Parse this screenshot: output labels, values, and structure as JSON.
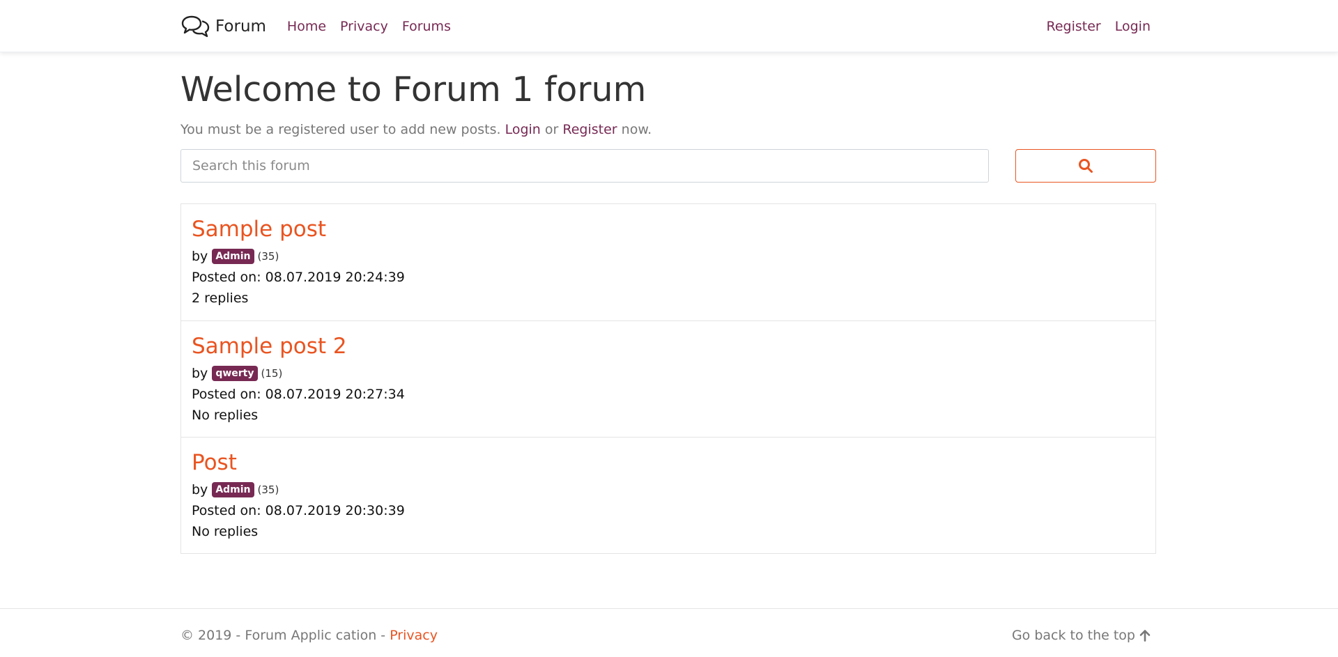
{
  "nav": {
    "brand": "Forum",
    "links": [
      "Home",
      "Privacy",
      "Forums"
    ],
    "right_links": [
      "Register",
      "Login"
    ]
  },
  "main": {
    "title": "Welcome to Forum 1 forum",
    "intro_prefix": "You must be a registered user to add new posts.",
    "intro_login": "Login",
    "intro_or": "or",
    "intro_register": "Register",
    "intro_suffix": "now."
  },
  "search": {
    "placeholder": "Search this forum",
    "value": ""
  },
  "posts": [
    {
      "title": "Sample post",
      "by": "by",
      "author": "Admin",
      "count": "(35)",
      "posted": "Posted on: 08.07.2019 20:24:39",
      "replies": "2 replies"
    },
    {
      "title": "Sample post 2",
      "by": "by",
      "author": "qwerty",
      "count": "(15)",
      "posted": "Posted on: 08.07.2019 20:27:34",
      "replies": "No replies"
    },
    {
      "title": "Post",
      "by": "by",
      "author": "Admin",
      "count": "(35)",
      "posted": "Posted on: 08.07.2019 20:30:39",
      "replies": "No replies"
    }
  ],
  "footer": {
    "copyright": "© 2019 - Forum Applic cation - ",
    "privacy": "Privacy",
    "back_to_top": "Go back to the top"
  },
  "colors": {
    "accent": "#e95420",
    "primary": "#772953",
    "muted": "#777777"
  },
  "icons": {
    "brand": "chat-bubbles-icon",
    "search": "search-icon",
    "back_to_top": "arrow-up-icon"
  }
}
